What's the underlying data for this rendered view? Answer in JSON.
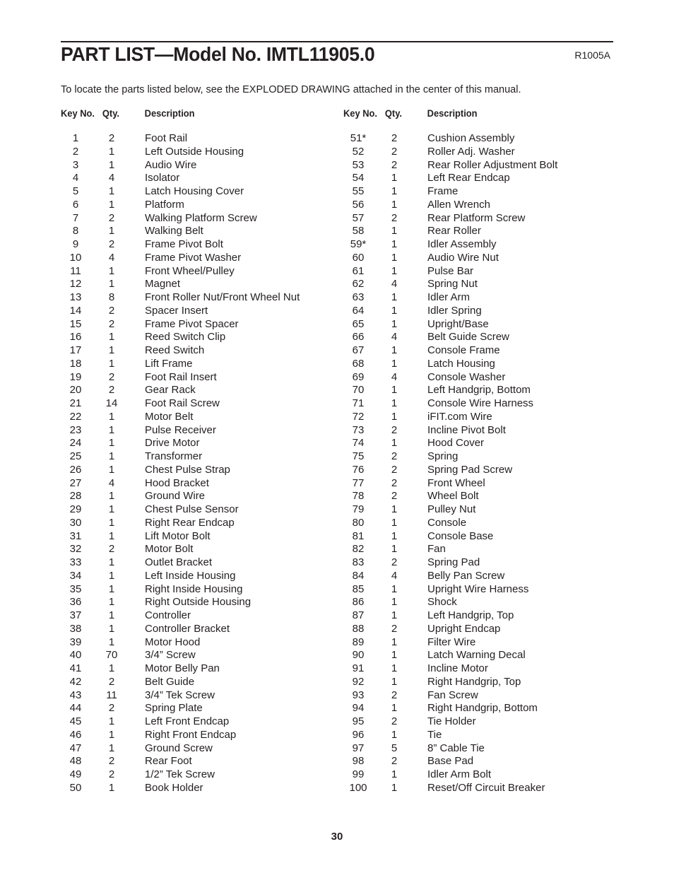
{
  "header": {
    "title": "PART LIST—Model No. IMTL11905.0",
    "code": "R1005A",
    "intro": "To locate the parts listed below, see the EXPLODED DRAWING attached in the center of this manual."
  },
  "columns": {
    "key_label": "Key No.",
    "qty_label": "Qty.",
    "desc_label": "Description"
  },
  "parts_left": [
    {
      "key": "1",
      "qty": "2",
      "desc": "Foot Rail"
    },
    {
      "key": "2",
      "qty": "1",
      "desc": "Left Outside Housing"
    },
    {
      "key": "3",
      "qty": "1",
      "desc": "Audio Wire"
    },
    {
      "key": "4",
      "qty": "4",
      "desc": "Isolator"
    },
    {
      "key": "5",
      "qty": "1",
      "desc": "Latch Housing Cover"
    },
    {
      "key": "6",
      "qty": "1",
      "desc": "Platform"
    },
    {
      "key": "7",
      "qty": "2",
      "desc": "Walking Platform Screw"
    },
    {
      "key": "8",
      "qty": "1",
      "desc": "Walking Belt"
    },
    {
      "key": "9",
      "qty": "2",
      "desc": "Frame Pivot Bolt"
    },
    {
      "key": "10",
      "qty": "4",
      "desc": "Frame Pivot Washer"
    },
    {
      "key": "11",
      "qty": "1",
      "desc": "Front Wheel/Pulley"
    },
    {
      "key": "12",
      "qty": "1",
      "desc": "Magnet"
    },
    {
      "key": "13",
      "qty": "8",
      "desc": "Front Roller Nut/Front Wheel Nut"
    },
    {
      "key": "14",
      "qty": "2",
      "desc": "Spacer Insert"
    },
    {
      "key": "15",
      "qty": "2",
      "desc": "Frame Pivot Spacer"
    },
    {
      "key": "16",
      "qty": "1",
      "desc": "Reed Switch Clip"
    },
    {
      "key": "17",
      "qty": "1",
      "desc": "Reed Switch"
    },
    {
      "key": "18",
      "qty": "1",
      "desc": "Lift Frame"
    },
    {
      "key": "19",
      "qty": "2",
      "desc": "Foot Rail Insert"
    },
    {
      "key": "20",
      "qty": "2",
      "desc": "Gear Rack"
    },
    {
      "key": "21",
      "qty": "14",
      "desc": "Foot Rail Screw"
    },
    {
      "key": "22",
      "qty": "1",
      "desc": "Motor Belt"
    },
    {
      "key": "23",
      "qty": "1",
      "desc": "Pulse Receiver"
    },
    {
      "key": "24",
      "qty": "1",
      "desc": "Drive Motor"
    },
    {
      "key": "25",
      "qty": "1",
      "desc": "Transformer"
    },
    {
      "key": "26",
      "qty": "1",
      "desc": "Chest Pulse Strap"
    },
    {
      "key": "27",
      "qty": "4",
      "desc": "Hood Bracket"
    },
    {
      "key": "28",
      "qty": "1",
      "desc": "Ground Wire"
    },
    {
      "key": "29",
      "qty": "1",
      "desc": "Chest Pulse Sensor"
    },
    {
      "key": "30",
      "qty": "1",
      "desc": "Right Rear Endcap"
    },
    {
      "key": "31",
      "qty": "1",
      "desc": "Lift Motor Bolt"
    },
    {
      "key": "32",
      "qty": "2",
      "desc": "Motor Bolt"
    },
    {
      "key": "33",
      "qty": "1",
      "desc": "Outlet Bracket"
    },
    {
      "key": "34",
      "qty": "1",
      "desc": "Left Inside Housing"
    },
    {
      "key": "35",
      "qty": "1",
      "desc": "Right Inside Housing"
    },
    {
      "key": "36",
      "qty": "1",
      "desc": "Right Outside Housing"
    },
    {
      "key": "37",
      "qty": "1",
      "desc": "Controller"
    },
    {
      "key": "38",
      "qty": "1",
      "desc": "Controller Bracket"
    },
    {
      "key": "39",
      "qty": "1",
      "desc": "Motor Hood"
    },
    {
      "key": "40",
      "qty": "70",
      "desc": "3/4” Screw"
    },
    {
      "key": "41",
      "qty": "1",
      "desc": "Motor Belly Pan"
    },
    {
      "key": "42",
      "qty": "2",
      "desc": "Belt Guide"
    },
    {
      "key": "43",
      "qty": "11",
      "desc": "3/4” Tek Screw"
    },
    {
      "key": "44",
      "qty": "2",
      "desc": "Spring Plate"
    },
    {
      "key": "45",
      "qty": "1",
      "desc": "Left Front Endcap"
    },
    {
      "key": "46",
      "qty": "1",
      "desc": "Right Front Endcap"
    },
    {
      "key": "47",
      "qty": "1",
      "desc": "Ground Screw"
    },
    {
      "key": "48",
      "qty": "2",
      "desc": "Rear Foot"
    },
    {
      "key": "49",
      "qty": "2",
      "desc": "1/2” Tek Screw"
    },
    {
      "key": "50",
      "qty": "1",
      "desc": "Book Holder"
    }
  ],
  "parts_right": [
    {
      "key": "51*",
      "qty": "2",
      "desc": "Cushion Assembly"
    },
    {
      "key": "52",
      "qty": "2",
      "desc": "Roller Adj. Washer"
    },
    {
      "key": "53",
      "qty": "2",
      "desc": "Rear Roller Adjustment Bolt"
    },
    {
      "key": "54",
      "qty": "1",
      "desc": "Left Rear Endcap"
    },
    {
      "key": "55",
      "qty": "1",
      "desc": "Frame"
    },
    {
      "key": "56",
      "qty": "1",
      "desc": "Allen Wrench"
    },
    {
      "key": "57",
      "qty": "2",
      "desc": "Rear Platform Screw"
    },
    {
      "key": "58",
      "qty": "1",
      "desc": "Rear Roller"
    },
    {
      "key": "59*",
      "qty": "1",
      "desc": "Idler Assembly"
    },
    {
      "key": "60",
      "qty": "1",
      "desc": "Audio Wire Nut"
    },
    {
      "key": "61",
      "qty": "1",
      "desc": "Pulse Bar"
    },
    {
      "key": "62",
      "qty": "4",
      "desc": "Spring Nut"
    },
    {
      "key": "63",
      "qty": "1",
      "desc": "Idler Arm"
    },
    {
      "key": "64",
      "qty": "1",
      "desc": "Idler Spring"
    },
    {
      "key": "65",
      "qty": "1",
      "desc": "Upright/Base"
    },
    {
      "key": "66",
      "qty": "4",
      "desc": "Belt Guide Screw"
    },
    {
      "key": "67",
      "qty": "1",
      "desc": "Console Frame"
    },
    {
      "key": "68",
      "qty": "1",
      "desc": "Latch Housing"
    },
    {
      "key": "69",
      "qty": "4",
      "desc": "Console Washer"
    },
    {
      "key": "70",
      "qty": "1",
      "desc": "Left Handgrip, Bottom"
    },
    {
      "key": "71",
      "qty": "1",
      "desc": "Console Wire Harness"
    },
    {
      "key": "72",
      "qty": "1",
      "desc": "iFIT.com Wire"
    },
    {
      "key": "73",
      "qty": "2",
      "desc": "Incline Pivot Bolt"
    },
    {
      "key": "74",
      "qty": "1",
      "desc": "Hood Cover"
    },
    {
      "key": "75",
      "qty": "2",
      "desc": "Spring"
    },
    {
      "key": "76",
      "qty": "2",
      "desc": "Spring Pad Screw"
    },
    {
      "key": "77",
      "qty": "2",
      "desc": "Front Wheel"
    },
    {
      "key": "78",
      "qty": "2",
      "desc": "Wheel Bolt"
    },
    {
      "key": "79",
      "qty": "1",
      "desc": "Pulley Nut"
    },
    {
      "key": "80",
      "qty": "1",
      "desc": "Console"
    },
    {
      "key": "81",
      "qty": "1",
      "desc": "Console Base"
    },
    {
      "key": "82",
      "qty": "1",
      "desc": "Fan"
    },
    {
      "key": "83",
      "qty": "2",
      "desc": "Spring Pad"
    },
    {
      "key": "84",
      "qty": "4",
      "desc": "Belly Pan Screw"
    },
    {
      "key": "85",
      "qty": "1",
      "desc": "Upright Wire Harness"
    },
    {
      "key": "86",
      "qty": "1",
      "desc": "Shock"
    },
    {
      "key": "87",
      "qty": "1",
      "desc": "Left Handgrip, Top"
    },
    {
      "key": "88",
      "qty": "2",
      "desc": "Upright Endcap"
    },
    {
      "key": "89",
      "qty": "1",
      "desc": "Filter Wire"
    },
    {
      "key": "90",
      "qty": "1",
      "desc": "Latch Warning Decal"
    },
    {
      "key": "91",
      "qty": "1",
      "desc": "Incline Motor"
    },
    {
      "key": "92",
      "qty": "1",
      "desc": "Right Handgrip, Top"
    },
    {
      "key": "93",
      "qty": "2",
      "desc": "Fan Screw"
    },
    {
      "key": "94",
      "qty": "1",
      "desc": "Right Handgrip, Bottom"
    },
    {
      "key": "95",
      "qty": "2",
      "desc": "Tie Holder"
    },
    {
      "key": "96",
      "qty": "1",
      "desc": "Tie"
    },
    {
      "key": "97",
      "qty": "5",
      "desc": "8” Cable Tie"
    },
    {
      "key": "98",
      "qty": "2",
      "desc": "Base Pad"
    },
    {
      "key": "99",
      "qty": "1",
      "desc": "Idler Arm Bolt"
    },
    {
      "key": "100",
      "qty": "1",
      "desc": "Reset/Off Circuit Breaker"
    }
  ],
  "footer": {
    "page_number": "30"
  }
}
